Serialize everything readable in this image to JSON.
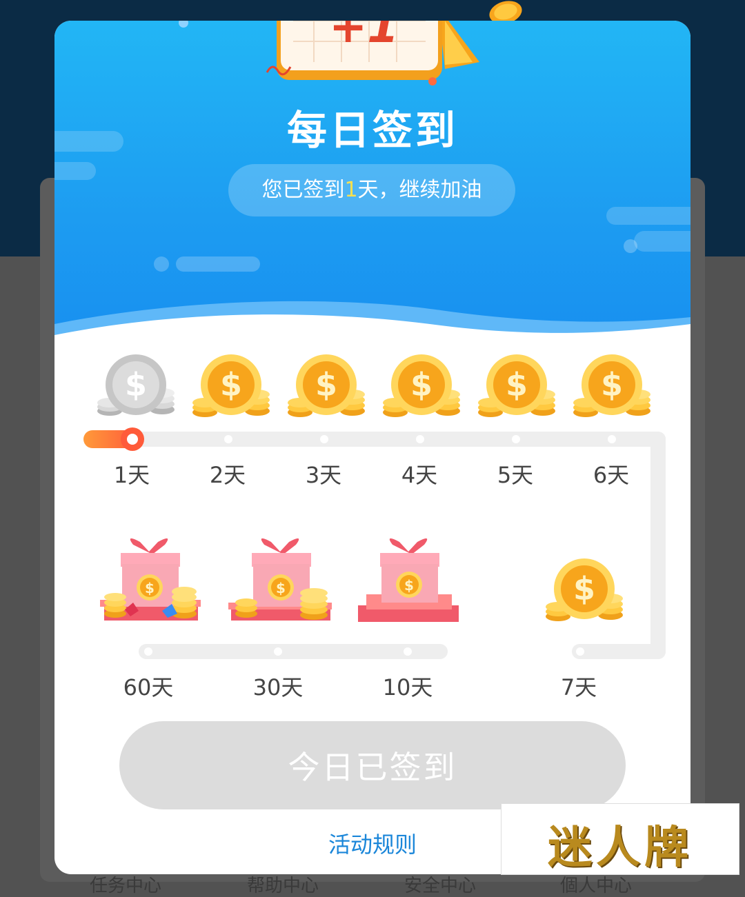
{
  "background": {
    "tabs": [
      "任务中心",
      "帮助中心",
      "安全中心",
      "個人中心"
    ]
  },
  "calendar_badge": "+1",
  "modal": {
    "title": "每日签到",
    "status": {
      "prefix": "您已签到",
      "days": "1",
      "suffix": "天，继续加油"
    },
    "rewards_row1": [
      {
        "label": "1天",
        "type": "coin",
        "claimed": true
      },
      {
        "label": "2天",
        "type": "coin",
        "claimed": false
      },
      {
        "label": "3天",
        "type": "coin",
        "claimed": false
      },
      {
        "label": "4天",
        "type": "coin",
        "claimed": false
      },
      {
        "label": "5天",
        "type": "coin",
        "claimed": false
      },
      {
        "label": "6天",
        "type": "coin",
        "claimed": false
      }
    ],
    "rewards_row2": [
      {
        "label": "60天",
        "type": "gift-gems"
      },
      {
        "label": "30天",
        "type": "gift-coins"
      },
      {
        "label": "10天",
        "type": "gift"
      },
      {
        "label": "7天",
        "type": "coin"
      }
    ],
    "progress_days": 1,
    "button_label": "今日已签到",
    "rules_link": "活动规则"
  },
  "watermark": "迷人牌",
  "colors": {
    "header_top": "#22b6f5",
    "header_bottom": "#168cf0",
    "coin_gold": "#f7a51c",
    "coin_silver": "#c8c8c8",
    "progress": "#ff5b3a",
    "link": "#1a86d9",
    "button_disabled": "#dcdcdc"
  }
}
